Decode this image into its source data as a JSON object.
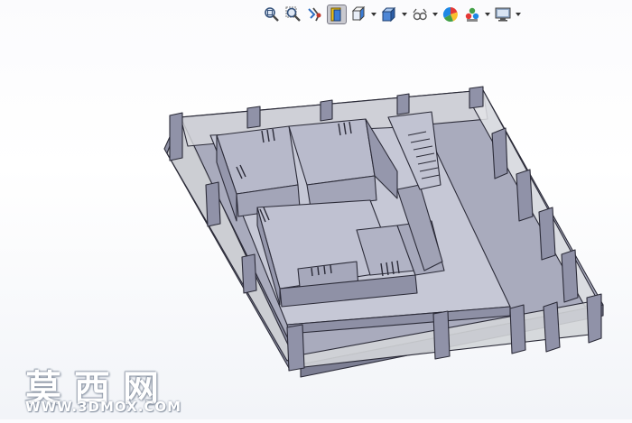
{
  "toolbar": {
    "items": [
      {
        "icon": "zoom-to-fit-icon",
        "has_dropdown": false,
        "active": false
      },
      {
        "icon": "zoom-to-area-icon",
        "has_dropdown": false,
        "active": false
      },
      {
        "icon": "previous-view-icon",
        "has_dropdown": false,
        "active": false
      },
      {
        "icon": "section-view-icon",
        "has_dropdown": false,
        "active": true
      },
      {
        "icon": "view-orientation-icon",
        "has_dropdown": true,
        "active": false
      },
      {
        "icon": "display-style-icon",
        "has_dropdown": true,
        "active": false
      },
      {
        "icon": "hide-show-items-icon",
        "has_dropdown": true,
        "active": false
      },
      {
        "icon": "edit-appearance-icon",
        "has_dropdown": false,
        "active": false
      },
      {
        "icon": "apply-scene-icon",
        "has_dropdown": true,
        "active": false
      },
      {
        "icon": "view-settings-icon",
        "has_dropdown": true,
        "active": false
      }
    ]
  },
  "model": {
    "name": "3d-house-floor-model",
    "colors": {
      "base": "#c5c7d6",
      "wall": "#b4b6c7",
      "wall_dark": "#8e90a5",
      "glass": "#d8dadc",
      "edge": "#2b2b38"
    }
  },
  "watermark": {
    "title": "莫西网",
    "url": "WWW.3DMOX.COM"
  }
}
